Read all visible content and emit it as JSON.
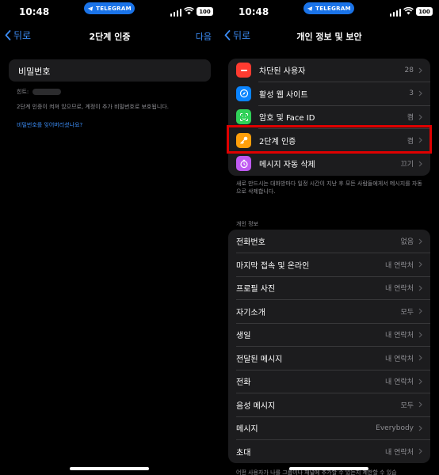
{
  "status_bar": {
    "time": "10:48",
    "telegram_pill": "TELEGRAM",
    "battery": "100"
  },
  "left": {
    "nav": {
      "back": "뒤로",
      "title": "2단계 인증",
      "next": "다음"
    },
    "password_field": "비밀번호",
    "hint_label": "힌트:",
    "description": "2단계 인증이 켜져 있으므로, 계정이 추가 비밀번호로 보호됩니다.",
    "forgot_link": "비밀번호를 잊어버리셨나요?"
  },
  "right": {
    "nav": {
      "back": "뒤로",
      "title": "개인 정보 및 보안"
    },
    "security_rows": [
      {
        "label": "차단된 사용자",
        "value": "28",
        "icon": "block-icon",
        "color": "#ff3b30"
      },
      {
        "label": "활성 웹 사이트",
        "value": "3",
        "icon": "compass-icon",
        "color": "#0a84ff"
      },
      {
        "label": "암호 및 Face ID",
        "value": "켬",
        "icon": "faceid-icon",
        "color": "#30d158"
      },
      {
        "label": "2단계 인증",
        "value": "켬",
        "icon": "key-icon",
        "color": "#ff9f0a"
      },
      {
        "label": "메시지 자동 삭제",
        "value": "끄기",
        "icon": "timer-icon",
        "color": "#bf5af2"
      }
    ],
    "auto_delete_note": "새로 만드시는 대화방마다 일정 시간이 지난 후 모든 사람들에게서 메시지를 자동으로 삭제합니다.",
    "privacy_header": "개인 정보",
    "privacy_rows": [
      {
        "label": "전화번호",
        "value": "없음"
      },
      {
        "label": "마지막 접속 및 온라인",
        "value": "내 연락처"
      },
      {
        "label": "프로필 사진",
        "value": "내 연락처"
      },
      {
        "label": "자기소개",
        "value": "모두"
      },
      {
        "label": "생일",
        "value": "내 연락처"
      },
      {
        "label": "전달된 메시지",
        "value": "내 연락처"
      },
      {
        "label": "전화",
        "value": "내 연락처"
      },
      {
        "label": "음성 메시지",
        "value": "모두"
      },
      {
        "label": "메시지",
        "value": "Everybody"
      },
      {
        "label": "초대",
        "value": "내 연락처"
      }
    ],
    "bottom_note": "어떤 사용자가 나를 그룹이나 채널에 추가할 수 있는지 제한할 수 있습"
  },
  "colors": {
    "accent": "#3b8cf5",
    "highlight": "#e00000",
    "cell": "#1c1c1e"
  }
}
